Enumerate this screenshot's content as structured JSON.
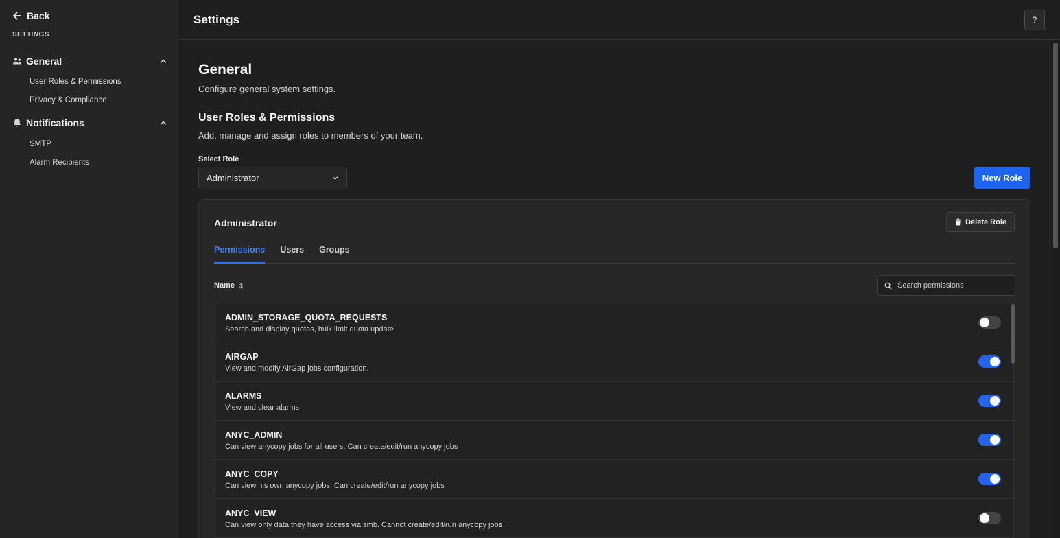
{
  "sidebar": {
    "back_label": "Back",
    "caption": "SETTINGS",
    "groups": [
      {
        "label": "General",
        "icon": "users-icon",
        "items": [
          "User Roles & Permissions",
          "Privacy & Compliance"
        ]
      },
      {
        "label": "Notifications",
        "icon": "bell-icon",
        "items": [
          "SMTP",
          "Alarm Recipients"
        ]
      }
    ]
  },
  "header": {
    "title": "Settings",
    "help_label": "?"
  },
  "main": {
    "section_title": "General",
    "section_desc": "Configure general system settings.",
    "roles_title": "User Roles & Permissions",
    "roles_desc": "Add, manage and assign roles to members of your team.",
    "select_label": "Select Role",
    "selected_role": "Administrator",
    "new_role_label": "New Role"
  },
  "card": {
    "title": "Administrator",
    "delete_label": "Delete Role",
    "tabs": [
      "Permissions",
      "Users",
      "Groups"
    ],
    "active_tab": "Permissions",
    "column_name": "Name",
    "search_placeholder": "Search permissions",
    "permissions": [
      {
        "name": "ADMIN_STORAGE_QUOTA_REQUESTS",
        "desc": "Search and display quotas, bulk limit quota update",
        "enabled": false
      },
      {
        "name": "AIRGAP",
        "desc": "View and modify AirGap jobs configuration.",
        "enabled": true
      },
      {
        "name": "ALARMS",
        "desc": "View and clear alarms",
        "enabled": true
      },
      {
        "name": "ANYC_ADMIN",
        "desc": "Can view anycopy jobs for all users. Can create/edit/run anycopy jobs",
        "enabled": true
      },
      {
        "name": "ANYC_COPY",
        "desc": "Can view his own anycopy jobs. Can create/edit/run anycopy jobs",
        "enabled": true
      },
      {
        "name": "ANYC_VIEW",
        "desc": "Can view only data they have access via smb. Cannot create/edit/run anycopy jobs",
        "enabled": false
      }
    ]
  },
  "colors": {
    "accent": "#1e64f0",
    "toggle_on": "#2563eb",
    "toggle_off": "#444444"
  }
}
